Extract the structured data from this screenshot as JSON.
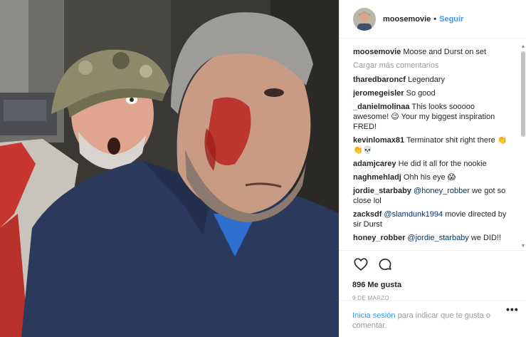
{
  "post": {
    "username": "moosemovie",
    "separator": "•",
    "follow_label": "Seguir",
    "caption_user": "moosemovie",
    "caption_text": "Moose and Durst on set",
    "load_more_label": "Cargar más comentarios",
    "likes_text": "896 Me gusta",
    "date_text": "9 DE MARZO"
  },
  "comments": [
    {
      "user": "tharedbaroncf",
      "text": "Legendary"
    },
    {
      "user": "jeromegeisler",
      "text": "So good"
    },
    {
      "user": "_danielmolinaa",
      "text": "This looks sooooo awesome! 😉 Your my biggest inspiration FRED!"
    },
    {
      "user": "kevinlomax81",
      "text": "Terminator shit right there 👏👏💀"
    },
    {
      "user": "adamjcarey",
      "text": "He did it all for the nookie"
    },
    {
      "user": "naghmehladj",
      "text": "Ohh his eye 😱"
    },
    {
      "user": "jordie_starbaby",
      "mention": "@honey_robber",
      "text": "we got so close lol"
    },
    {
      "user": "zacksdf",
      "mention": "@slamdunk1994",
      "text": "movie directed by sir Durst"
    },
    {
      "user": "honey_robber",
      "mention": "@jordie_starbaby",
      "text": "we DID!!"
    }
  ],
  "login": {
    "link_text": "Inicia sesión",
    "rest_text": "para indicar que te gusta o comentar."
  },
  "more_label": "•••",
  "icons": {
    "like": "heart-icon",
    "comment": "comment-bubble-icon",
    "more": "more-options-icon"
  },
  "colors": {
    "link_blue": "#3897f0",
    "mention_blue": "#003569",
    "muted": "#999999",
    "text": "#262626"
  }
}
